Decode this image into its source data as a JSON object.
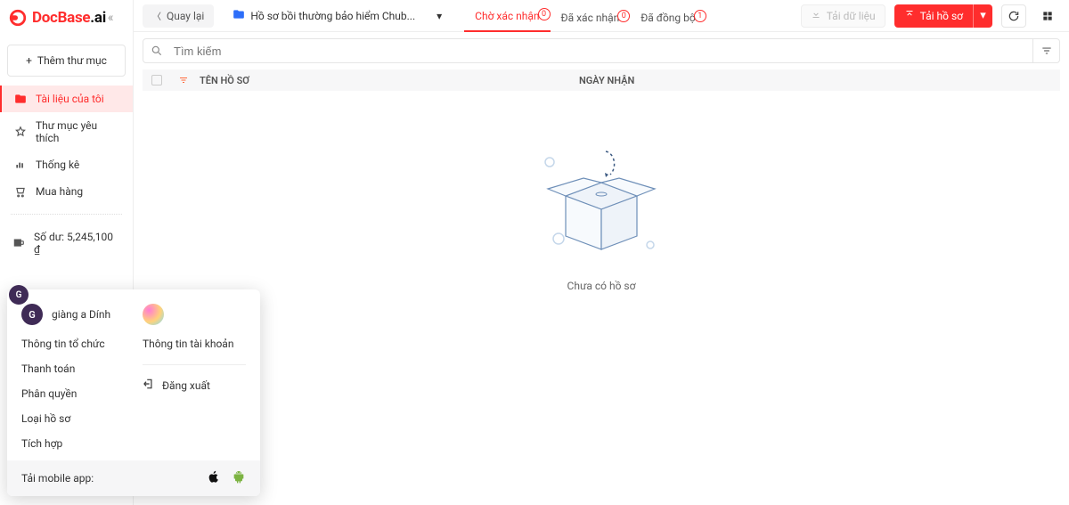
{
  "logo": {
    "brand": "DocBase",
    "suffix": ".ai"
  },
  "sidebar": {
    "add_folder": "Thêm thư mục",
    "items": [
      {
        "label": "Tài liệu của tôi"
      },
      {
        "label": "Thư mục yêu thích"
      },
      {
        "label": "Thống kê"
      },
      {
        "label": "Mua hàng"
      }
    ],
    "balance_label": "Số dư:",
    "balance_value": "5,245,100 ₫"
  },
  "topbar": {
    "back": "Quay lại",
    "folder": "Hồ sơ bồi thường bảo hiểm Chub...",
    "tabs": [
      {
        "label": "Chờ xác nhận",
        "count": "0"
      },
      {
        "label": "Đã xác nhận",
        "count": "0"
      },
      {
        "label": "Đã đồng bộ",
        "count": "1"
      }
    ],
    "download": "Tải dữ liệu",
    "upload": "Tải hồ sơ"
  },
  "search": {
    "placeholder": "Tìm kiếm"
  },
  "table": {
    "col_name": "TÊN HỒ SƠ",
    "col_date": "NGÀY NHẬN",
    "empty": "Chưa có hồ sơ"
  },
  "popup": {
    "org_initial": "G",
    "org_name": "giàng a Dính",
    "org_links": [
      "Thông tin tổ chức",
      "Thanh toán",
      "Phân quyền",
      "Loại hồ sơ",
      "Tích hợp"
    ],
    "account_link": "Thông tin tài khoản",
    "logout": "Đăng xuất",
    "footer": "Tải mobile app:"
  }
}
